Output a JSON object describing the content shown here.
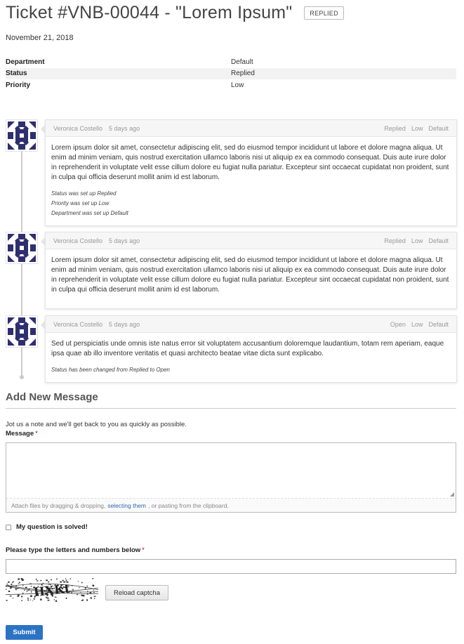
{
  "ticket": {
    "title": "Ticket #VNB-00044 - \"Lorem Ipsum\"",
    "status_badge": "REPLIED",
    "date": "November 21, 2018",
    "meta": [
      {
        "key": "Department",
        "value": "Default"
      },
      {
        "key": "Status",
        "value": "Replied"
      },
      {
        "key": "Priority",
        "value": "Low"
      }
    ]
  },
  "messages": [
    {
      "author": "Veronica Costello",
      "time": "5 days ago",
      "tags": [
        "Replied",
        "Low",
        "Default"
      ],
      "body": "Lorem ipsum dolor sit amet, consectetur adipiscing elit, sed do eiusmod tempor incididunt ut labore et dolore magna aliqua. Ut enim ad minim veniam, quis nostrud exercitation ullamco laboris nisi ut aliquip ex ea commodo consequat. Duis aute irure dolor in reprehenderit in voluptate velit esse cillum dolore eu fugiat nulla pariatur. Excepteur sint occaecat cupidatat non proident, sunt in culpa qui officia deserunt mollit anim id est laborum.",
      "notes": [
        "Status was set up Replied",
        "Priority was set up Low",
        "Department was set up Default"
      ]
    },
    {
      "author": "Veronica Costello",
      "time": "5 days ago",
      "tags": [
        "Replied",
        "Low",
        "Default"
      ],
      "body": "Lorem ipsum dolor sit amet, consectetur adipiscing elit, sed do eiusmod tempor incididunt ut labore et dolore magna aliqua. Ut enim ad minim veniam, quis nostrud exercitation ullamco laboris nisi ut aliquip ex ea commodo consequat. Duis aute irure dolor in reprehenderit in voluptate velit esse cillum dolore eu fugiat nulla pariatur. Excepteur sint occaecat cupidatat non proident, sunt in culpa qui officia deserunt mollit anim id est laborum.",
      "notes": []
    },
    {
      "author": "Veronica Costello",
      "time": "5 days ago",
      "tags": [
        "Open",
        "Low",
        "Default"
      ],
      "body": "Sed ut perspiciatis unde omnis iste natus error sit voluptatem accusantium doloremque laudantium, totam rem aperiam, eaque ipsa quae ab illo inventore veritatis et quasi architecto beatae vitae dicta sunt explicabo.",
      "notes": [
        "Status has been changed from Replied to Open"
      ]
    }
  ],
  "form": {
    "heading": "Add New Message",
    "hint": "Jot us a note and we'll get back to you as quickly as possible.",
    "message_label": "Message",
    "required_mark": "*",
    "message_value": "",
    "attach_before": "Attach files by dragging & dropping,",
    "attach_link": "selecting them",
    "attach_after": ", or pasting from the clipboard.",
    "solved_label": "My question is solved!",
    "solved_checked": false,
    "captcha_label": "Please type the letters and numbers below",
    "captcha_value": "",
    "captcha_text": "HXKt",
    "reload_label": "Reload captcha",
    "submit_label": "Submit"
  },
  "colors": {
    "accent": "#2d73c4",
    "avatar": "#2e2f6e",
    "required": "#cc0000"
  },
  "icons": {
    "avatar": "identicon-avatar-icon",
    "checkbox": "checkbox-icon",
    "resize": "resize-grip-icon"
  }
}
